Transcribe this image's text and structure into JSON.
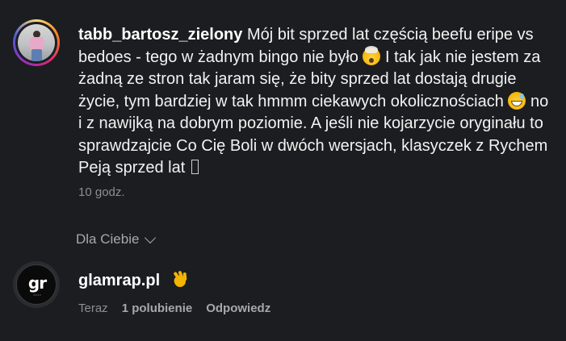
{
  "comment": {
    "username": "tabb_bartosz_zielony",
    "text_part1": "Mój bit sprzed lat częścią beefu eripe vs bedoes - tego w żadnym bingo nie było",
    "emoji1": "mind-blown-emoji",
    "text_part2": "I tak jak nie jestem za żadną ze stron tak jaram się, że bity sprzed lat dostają drugie życie, tym bardziej w tak hmmm ciekawych okolicznościach",
    "emoji2": "grinning-sweat-emoji",
    "text_part3": "no i z nawijką na dobrym poziomie. A jeśli nie kojarzycie oryginału to sprawdzajcie Co Cię Boli w dwóch wersjach, klasyczek z Rychem Peją sprzed lat",
    "emoji3": "missing-glyph",
    "time": "10 godz."
  },
  "filter": {
    "label": "Dla Ciebie"
  },
  "reply": {
    "logo_text": "gr",
    "username": "glamrap.pl",
    "emoji": "clapping-hands-emoji",
    "time": "Teraz",
    "likes": "1 polubienie",
    "reply_label": "Odpowiedz"
  },
  "colors": {
    "background": "#1b1d20",
    "text": "#f2f2f2",
    "muted": "#8e8e8e"
  }
}
